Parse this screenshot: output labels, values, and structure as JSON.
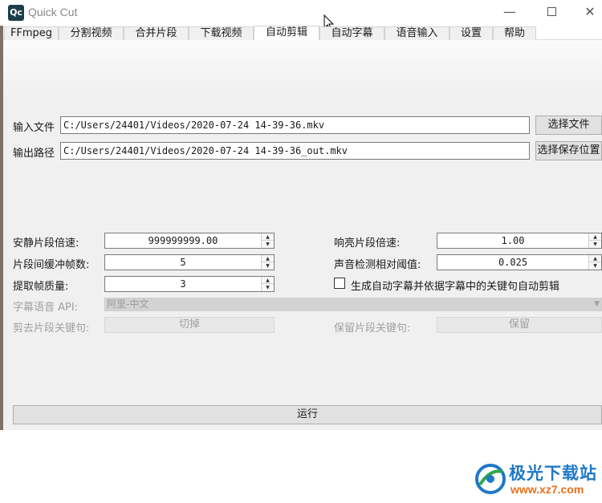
{
  "app": {
    "icon_text": "Qc",
    "title": "Quick Cut"
  },
  "window_controls": {
    "minimize": "—",
    "close": "✕"
  },
  "tabs": [
    {
      "label": "FFmpeg"
    },
    {
      "label": "分割视频"
    },
    {
      "label": "合并片段"
    },
    {
      "label": "下载视频"
    },
    {
      "label": "自动剪辑"
    },
    {
      "label": "自动字幕"
    },
    {
      "label": "语音输入"
    },
    {
      "label": "设置"
    },
    {
      "label": "帮助"
    }
  ],
  "active_tab": "自动剪辑",
  "form": {
    "input_file_label": "输入文件",
    "input_file_value": "C:/Users/24401/Videos/2020-07-24 14-39-36.mkv",
    "choose_file_button": "选择文件",
    "output_path_label": "输出路径",
    "output_path_value": "C:/Users/24401/Videos/2020-07-24 14-39-36_out.mkv",
    "choose_save_button": "选择保存位置",
    "silent_speed_label": "安静片段倍速:",
    "silent_speed_value": "999999999.00",
    "loud_speed_label": "响亮片段倍速:",
    "loud_speed_value": "1.00",
    "buffer_frames_label": "片段间缓冲帧数:",
    "buffer_frames_value": "5",
    "threshold_label": "声音检测相对阈值:",
    "threshold_value": "0.025",
    "frame_quality_label": "提取帧质量:",
    "frame_quality_value": "3",
    "subtitle_cut_label": "生成自动字幕并依据字幕中的关键句自动剪辑",
    "subtitle_cut_checked": false,
    "speech_api_label": "字幕语音 API:",
    "speech_api_value": "阿里-中文",
    "cut_keyword_label": "剪去片段关键句:",
    "cut_keyword_value": "切掉",
    "keep_keyword_label": "保留片段关键句:",
    "keep_keyword_value": "保留",
    "run_button": "运行"
  },
  "watermark": {
    "name": "极光下载站",
    "url": "www.xz7.com"
  },
  "colors": {
    "panel": "#f0f0f0",
    "button": "#e1e1e1",
    "watermark_blue": "#1f78c8",
    "watermark_orange": "#e8701c"
  }
}
